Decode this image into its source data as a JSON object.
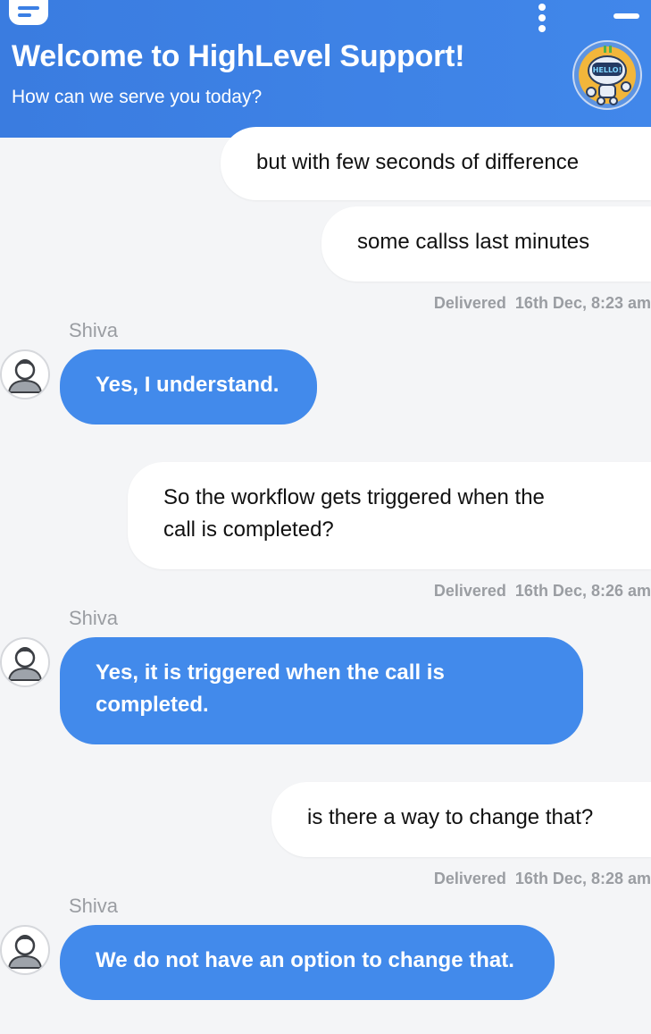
{
  "header": {
    "title": "Welcome to HighLevel Support!",
    "subtitle": "How can we serve you today?",
    "bot_badge_text": "HELLO!"
  },
  "colors": {
    "header_blue": "#3d82e6",
    "agent_bubble": "#428aeb",
    "user_bubble": "#ffffff",
    "background": "#f4f5f7",
    "meta_text": "#9a9da2"
  },
  "messages": [
    {
      "from": "user",
      "text": "but with few seconds of difference"
    },
    {
      "from": "user",
      "text": "some callss last minutes",
      "status": "Delivered",
      "time": "16th Dec, 8:23 am"
    },
    {
      "from": "agent",
      "sender": "Shiva",
      "text": "Yes, I understand."
    },
    {
      "from": "user",
      "lines": [
        "So the workflow gets triggered when the",
        "call is completed?"
      ],
      "status": "Delivered",
      "time": "16th Dec, 8:26 am"
    },
    {
      "from": "agent",
      "sender": "Shiva",
      "lines": [
        "Yes, it is triggered when the call is",
        "completed."
      ]
    },
    {
      "from": "user",
      "text": "is there a way to change that?",
      "status": "Delivered",
      "time": "16th Dec, 8:28 am"
    },
    {
      "from": "agent",
      "sender": "Shiva",
      "text": "We do not have an option to change that."
    }
  ]
}
